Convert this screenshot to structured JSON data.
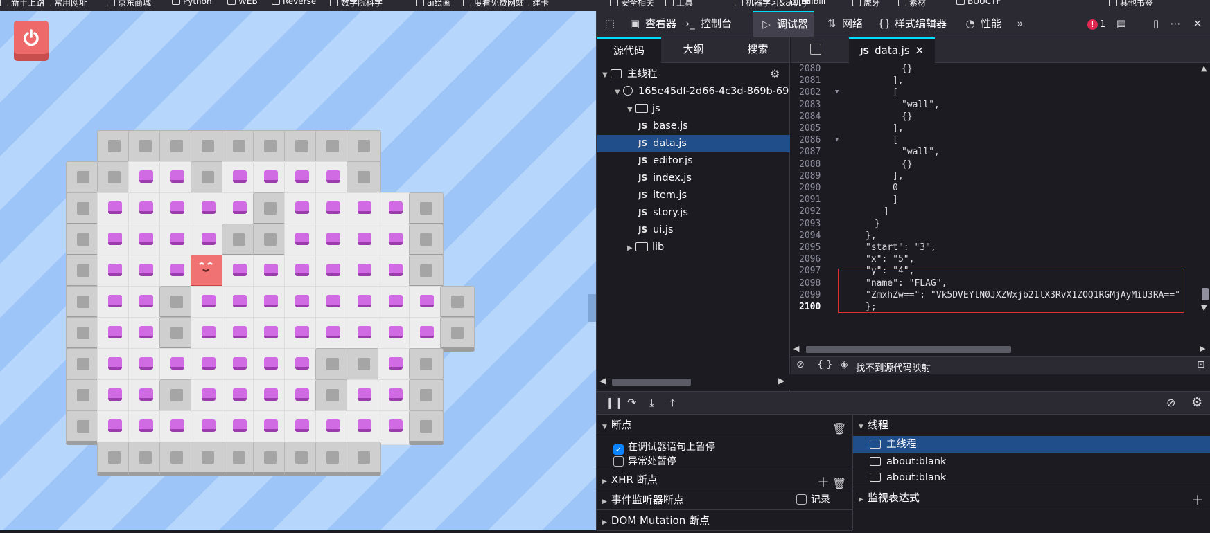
{
  "bookmarks": [
    "新手上路",
    "常用网址",
    "京东商城",
    "Python",
    "WEB",
    "Reverse",
    "数学院科学",
    "ai绘画",
    "度看免费网站",
    "建卡",
    "安全相关",
    "工具",
    "机器学习&ai机学",
    "bilibili",
    "虎牙",
    "素材",
    "BUUCTF",
    "其他书签"
  ],
  "devtools": {
    "toolbar": [
      "查看器",
      "控制台",
      "调试器",
      "网络",
      "样式编辑器",
      "性能"
    ],
    "error_count": "1",
    "source_tabs": [
      "源代码",
      "大纲",
      "搜索"
    ],
    "tree": {
      "main_thread": "主线程",
      "host": "165e45df-2d66-4c3d-869b-6913",
      "js_folder": "js",
      "files": [
        "base.js",
        "data.js",
        "editor.js",
        "index.js",
        "item.js",
        "story.js",
        "ui.js"
      ],
      "lib_folder": "lib"
    },
    "editor_tab": "data.js",
    "code_lines": [
      {
        "n": "2080",
        "text": "{}"
      },
      {
        "n": "2081",
        "text": "],"
      },
      {
        "n": "2082",
        "text": "["
      },
      {
        "n": "2083",
        "text": "\"wall\","
      },
      {
        "n": "2084",
        "text": "{}"
      },
      {
        "n": "2085",
        "text": "],"
      },
      {
        "n": "2086",
        "text": "["
      },
      {
        "n": "2087",
        "text": "\"wall\","
      },
      {
        "n": "2088",
        "text": "{}"
      },
      {
        "n": "2089",
        "text": "],"
      },
      {
        "n": "2090",
        "text": "0"
      },
      {
        "n": "2091",
        "text": "]"
      },
      {
        "n": "2092",
        "text": "]"
      },
      {
        "n": "2093",
        "text": "}"
      },
      {
        "n": "2094",
        "text": "},"
      },
      {
        "n": "2095",
        "text": "\"start\": \"3\","
      },
      {
        "n": "2096",
        "text": "\"x\": \"5\","
      },
      {
        "n": "2097",
        "text": "\"y\": \"4\","
      },
      {
        "n": "2098",
        "text": "\"name\": \"FLAG\","
      },
      {
        "n": "2099",
        "text": "\"ZmxhZw==\": \"Vk5DVEYlN0JXZWxjb21lX3RvX1ZOQ1RGMjAyMiU3RA==\""
      },
      {
        "n": "2100",
        "text": "};"
      }
    ],
    "status_bar": "找不到源代码映射",
    "breakpoints": {
      "title": "断点",
      "pause_on_debugger": "在调试器语句上暂停",
      "pause_on_debugger_checked": true,
      "pause_on_exceptions": "异常处暂停",
      "pause_on_exceptions_checked": false,
      "xhr": "XHR 断点",
      "event_listener": "事件监听器断点",
      "record": "记录",
      "dom_mutation": "DOM Mutation 断点"
    },
    "threads": {
      "title": "线程",
      "items": [
        "主线程",
        "about:blank",
        "about:blank"
      ]
    },
    "watch": "监视表达式"
  },
  "game": {
    "board_legend": "# wall, o floor with gem, . empty floor, P player",
    "board_rows": [
      "   #########   ",
      "  ##oo#oooo#   ",
      "  #ooooo#oooo# ",
      "  #oooo##oooo# ",
      "  #oooPoooooo# ",
      "  #oo#oooooooo#",
      "  #oo#oooooooo#",
      "  #ooooooo##o# ",
      "  #oo#oooo#oo# ",
      "  #oooooooooo# ",
      "   #########   "
    ]
  }
}
